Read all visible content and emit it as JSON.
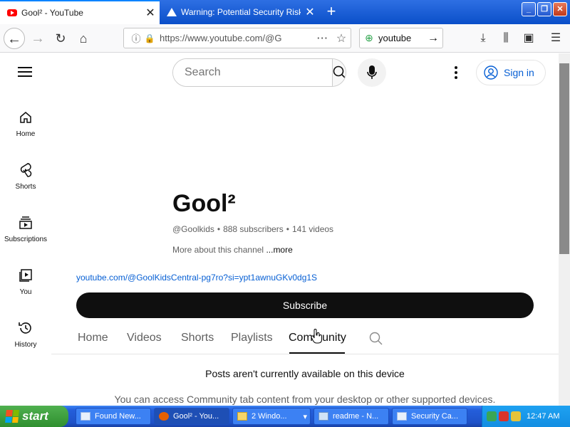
{
  "browser": {
    "tabs": [
      {
        "title": "Gool² - YouTube",
        "active": true
      },
      {
        "title": "Warning: Potential Security Risk A",
        "active": false
      }
    ],
    "url": "https://www.youtube.com/@G",
    "search_value": "youtube"
  },
  "yt": {
    "search_placeholder": "Search",
    "sign_in": "Sign in",
    "guide": [
      "Home",
      "Shorts",
      "Subscriptions",
      "You",
      "History"
    ],
    "channel": {
      "name": "Gool²",
      "handle": "@Goolkids",
      "subscribers": "888 subscribers",
      "videos": "141 videos",
      "about": "More about this channel",
      "more": "...more",
      "link": "youtube.com/@GoolKidsCentral-pg7ro?si=ypt1awnuGKv0dg1S",
      "subscribe": "Subscribe"
    },
    "tabs": [
      "Home",
      "Videos",
      "Shorts",
      "Playlists",
      "Community"
    ],
    "active_tab": "Community",
    "posts_message": "Posts aren't currently available on this device",
    "posts_sub": "You can access Community tab content from your desktop or other supported devices."
  },
  "taskbar": {
    "start": "start",
    "tasks": [
      "Found New...",
      "Gool² - You...",
      "2 Windo...",
      "readme - N...",
      "Security Ca..."
    ],
    "clock": "12:47 AM"
  }
}
